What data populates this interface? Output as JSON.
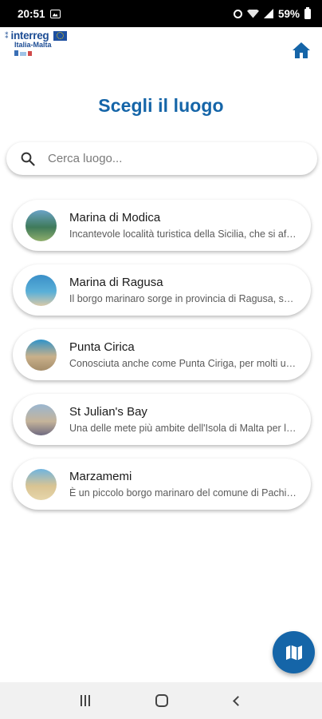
{
  "status_bar": {
    "time": "20:51",
    "battery_text": "59%",
    "icons": [
      "image-icon",
      "alarm-icon",
      "wifi-icon",
      "signal-icon",
      "battery-icon"
    ]
  },
  "logo": {
    "name": "interreg",
    "subtitle": "Italia-Malta"
  },
  "header": {
    "home_icon": "home-icon"
  },
  "page": {
    "title": "Scegli il luogo"
  },
  "search": {
    "placeholder": "Cerca luogo...",
    "value": "",
    "icon": "search-icon"
  },
  "places": [
    {
      "name": "Marina di Modica",
      "description": "Incantevole località turistica della Sicilia, che si affaccia sul mare",
      "colors": [
        "#6aa3c7",
        "#3f7a5a",
        "#8fae6b"
      ]
    },
    {
      "name": "Marina di Ragusa",
      "description": "Il borgo marinaro sorge in provincia di Ragusa, sulla costa",
      "colors": [
        "#3a8fc8",
        "#5ab0d8",
        "#d9c9a8"
      ]
    },
    {
      "name": "Punta Cirica",
      "description": "Conosciuta anche come Punta Ciriga, per molti una delle spiagge più belle",
      "colors": [
        "#2f93c9",
        "#c9b08a",
        "#a58d6a"
      ]
    },
    {
      "name": "St Julian's Bay",
      "description": "Una delle mete più ambite dell'Isola di Malta per la vita notturna",
      "colors": [
        "#9ab6d0",
        "#c5b49a",
        "#6f6a80"
      ]
    },
    {
      "name": "Marzamemi",
      "description": "È un piccolo borgo marinaro del comune di Pachino, in provincia di Siracusa",
      "colors": [
        "#6fb4df",
        "#d9c493",
        "#e6d5aa"
      ]
    }
  ],
  "fab": {
    "icon": "map-icon"
  },
  "nav_bar": {
    "icons": [
      "recent-apps-icon",
      "home-nav-icon",
      "back-icon"
    ]
  }
}
